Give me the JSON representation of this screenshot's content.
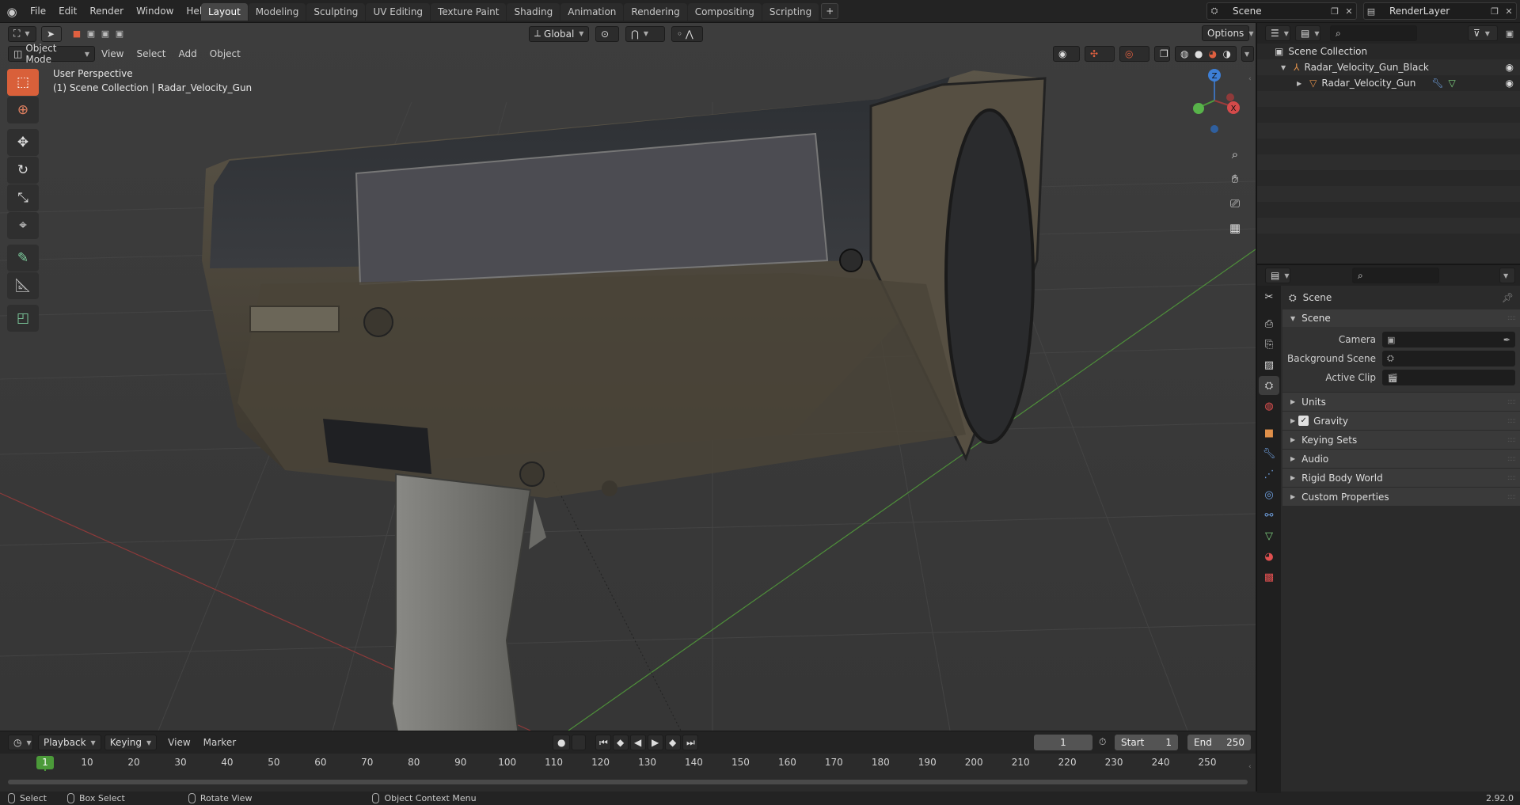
{
  "topbar": {
    "menus": [
      "File",
      "Edit",
      "Render",
      "Window",
      "Help"
    ],
    "workspaces": [
      "Layout",
      "Modeling",
      "Sculpting",
      "UV Editing",
      "Texture Paint",
      "Shading",
      "Animation",
      "Rendering",
      "Compositing",
      "Scripting"
    ],
    "active_workspace": "Layout",
    "add_tab": "+",
    "scene_name": "Scene",
    "view_layer": "RenderLayer"
  },
  "viewport": {
    "mode": "Object Mode",
    "menus": [
      "View",
      "Select",
      "Add",
      "Object"
    ],
    "orientation": "Global",
    "options_label": "Options",
    "perspective_label": "User Perspective",
    "collection_label": "(1) Scene Collection | Radar_Velocity_Gun",
    "gizmo_axes": {
      "x": "X",
      "y": "Y",
      "z": "Z"
    },
    "colors": {
      "x_axis": "#9c3b3b",
      "y_axis": "#4e9a3c",
      "z_axis": "#3d6fb5",
      "active_tool": "#d9603a"
    }
  },
  "timeline": {
    "menus": [
      "Playback",
      "Keying",
      "View",
      "Marker"
    ],
    "current_frame": "1",
    "start_label": "Start",
    "start_value": "1",
    "end_label": "End",
    "end_value": "250",
    "ticks": [
      "1",
      "10",
      "20",
      "30",
      "40",
      "50",
      "60",
      "70",
      "80",
      "90",
      "100",
      "110",
      "120",
      "130",
      "140",
      "150",
      "160",
      "170",
      "180",
      "190",
      "200",
      "210",
      "220",
      "230",
      "240",
      "250"
    ]
  },
  "statusbar": {
    "select": "Select",
    "box_select": "Box Select",
    "rotate_view": "Rotate View",
    "context_menu": "Object Context Menu",
    "version": "2.92.0"
  },
  "outliner": {
    "root": "Scene Collection",
    "collection": "Radar_Velocity_Gun_Black",
    "object": "Radar_Velocity_Gun"
  },
  "properties": {
    "breadcrumb": "Scene",
    "panel_title": "Scene",
    "camera_label": "Camera",
    "background_scene_label": "Background Scene",
    "active_clip_label": "Active Clip",
    "subpanels": [
      "Units",
      "Gravity",
      "Keying Sets",
      "Audio",
      "Rigid Body World",
      "Custom Properties"
    ],
    "gravity_checked": true
  }
}
